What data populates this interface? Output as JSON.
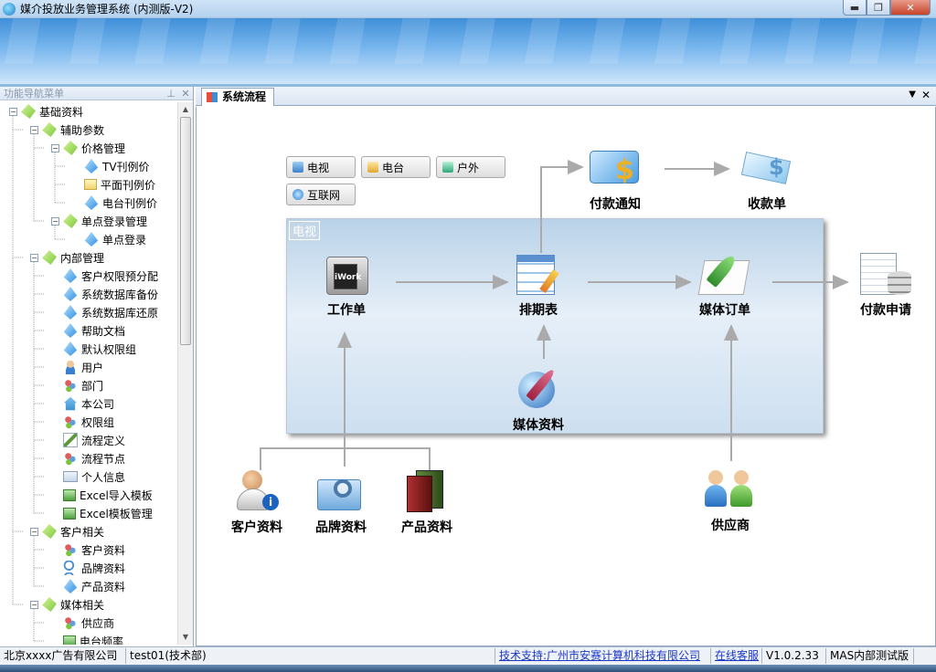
{
  "window": {
    "title": "媒介投放业务管理系统 (内测版-V2)",
    "min": "▬",
    "max": "❐",
    "close": "✕"
  },
  "sidebar": {
    "title": "功能导航菜单",
    "pin": "⊥",
    "close": "✕",
    "items": [
      {
        "label": "基础资料",
        "level": 0,
        "icon": "leaf-icon"
      },
      {
        "label": "辅助参数",
        "level": 1,
        "icon": "leaf-icon"
      },
      {
        "label": "价格管理",
        "level": 2,
        "icon": "leaf-icon"
      },
      {
        "label": "TV刊例价",
        "level": 3,
        "icon": "drop-icon"
      },
      {
        "label": "平面刊例价",
        "level": 3,
        "icon": "doc-icon"
      },
      {
        "label": "电台刊例价",
        "level": 3,
        "icon": "drop-icon"
      },
      {
        "label": "单点登录管理",
        "level": 2,
        "icon": "leaf-icon"
      },
      {
        "label": "单点登录",
        "level": 3,
        "icon": "drop-icon"
      },
      {
        "label": "内部管理",
        "level": 1,
        "icon": "leaf-icon"
      },
      {
        "label": "客户权限预分配",
        "level": 2,
        "icon": "drop-icon"
      },
      {
        "label": "系统数据库备份",
        "level": 2,
        "icon": "drop-icon"
      },
      {
        "label": "系统数据库还原",
        "level": 2,
        "icon": "drop-icon"
      },
      {
        "label": "帮助文档",
        "level": 2,
        "icon": "drop-icon"
      },
      {
        "label": "默认权限组",
        "level": 2,
        "icon": "drop-icon"
      },
      {
        "label": "用户",
        "level": 2,
        "icon": "person-icon"
      },
      {
        "label": "部门",
        "level": 2,
        "icon": "group-icon"
      },
      {
        "label": "本公司",
        "level": 2,
        "icon": "house-icon"
      },
      {
        "label": "权限组",
        "level": 2,
        "icon": "group-icon"
      },
      {
        "label": "流程定义",
        "level": 2,
        "icon": "pen-icon"
      },
      {
        "label": "流程节点",
        "level": 2,
        "icon": "group-icon"
      },
      {
        "label": "个人信息",
        "level": 2,
        "icon": "card-icon"
      },
      {
        "label": "Excel导入模板",
        "level": 2,
        "icon": "excel-icon"
      },
      {
        "label": "Excel模板管理",
        "level": 2,
        "icon": "excel-icon"
      },
      {
        "label": "客户相关",
        "level": 1,
        "icon": "leaf-icon"
      },
      {
        "label": "客户资料",
        "level": 2,
        "icon": "group-icon"
      },
      {
        "label": "品牌资料",
        "level": 2,
        "icon": "search-icon"
      },
      {
        "label": "产品资料",
        "level": 2,
        "icon": "drop-icon"
      },
      {
        "label": "媒体相关",
        "level": 1,
        "icon": "leaf-icon"
      },
      {
        "label": "供应商",
        "level": 2,
        "icon": "group-icon"
      },
      {
        "label": "电台频率",
        "level": 2,
        "icon": "excel-icon"
      }
    ]
  },
  "tabs": {
    "active": "系统流程",
    "dropdown": "▼",
    "close": "✕"
  },
  "flow": {
    "categories": [
      "电视",
      "电台",
      "户外",
      "互联网"
    ],
    "panel_tag": "电视",
    "nodes": {
      "workorder": "工作单",
      "schedule": "排期表",
      "media_order": "媒体订单",
      "media_info": "媒体资料",
      "payment_notice": "付款通知",
      "receipt": "收款单",
      "payment_request": "付款申请",
      "customer": "客户资料",
      "brand": "品牌资料",
      "product": "产品资料",
      "supplier": "供应商"
    }
  },
  "statusbar": {
    "company": "北京xxxx广告有限公司",
    "user": "test01(技术部)",
    "support": "技术支持:广州市安赛计算机科技有限公司",
    "online": "在线客服",
    "version": "V1.0.2.33",
    "mode": "MAS内部测试版"
  }
}
